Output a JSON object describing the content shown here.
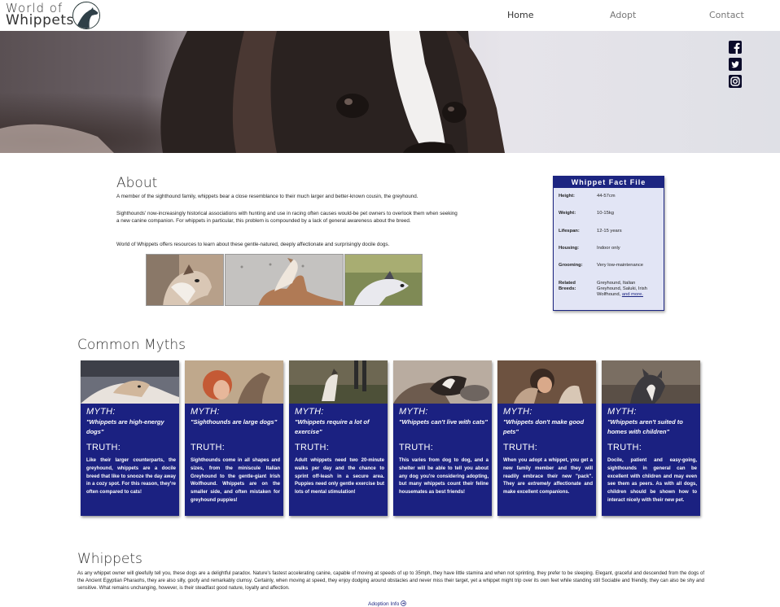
{
  "brand": {
    "line1": "World of",
    "line2": "Whippets",
    "icon": "whippet-head-icon"
  },
  "nav": {
    "items": [
      {
        "label": "Home",
        "active": true
      },
      {
        "label": "Adopt",
        "active": false
      },
      {
        "label": "Contact",
        "active": false
      }
    ]
  },
  "hero": {
    "social_icons": [
      "facebook-icon",
      "twitter-icon",
      "instagram-icon"
    ]
  },
  "about": {
    "title": "About",
    "paragraphs": [
      "A member of the sighthound family, whippets bear a close resemblance to their much larger and better-known cousin, the greyhound.",
      "Sighthounds' now-increasingly historical associations with hunting and use in racing often causes would-be pet owners to overlook them when seeking a new canine companion. For whippets in particular, this problem is compounded by a lack of general awareness about the breed.",
      "World of Whippets offers resources to learn about these gentle-natured, deeply affectionate and surprisingly docile dogs."
    ]
  },
  "fact_file": {
    "title": "Whippet Fact File",
    "rows": [
      {
        "key": "Height:",
        "value": "44-57cm"
      },
      {
        "key": "Weight:",
        "value": "10-15kg"
      },
      {
        "key": "Lifespan:",
        "value": "12-15 years"
      },
      {
        "key": "Housing:",
        "value": "Indoor only"
      },
      {
        "key": "Grooming:",
        "value": "Very low-maintenance"
      },
      {
        "key": "Related Breeds:",
        "value": "Greyhound, Italian Greyhound, Saluki, Irish Wolfhound,",
        "link": "and more."
      }
    ]
  },
  "myths": {
    "title": "Common Myths",
    "myth_heading": "MYTH:",
    "truth_heading": "TRUTH:",
    "cards": [
      {
        "myth": "\"Whippets are high-energy dogs\"",
        "truth": "Like their larger counterparts, the greyhound, whippets are a docile breed that like to snooze the day away in a cozy spot. For this reason, they're often compared to cats!"
      },
      {
        "myth": "\"Sighthounds are large dogs\"",
        "truth": "Sighthounds come in all shapes and sizes, from the miniscule Italian Greyhound to the gentle-giant Irish Wolfhound. Whippets are on the smaller side, and often mistaken for greyhound puppies!"
      },
      {
        "myth": "\"Whippets require a lot of exercise\"",
        "truth": "Adult whippets need two 20-minute walks per day and the chance to sprint off-leash in a secure area. Puppies need only gentle exercise but lots of mental stimulation!"
      },
      {
        "myth": "\"Whippets can't live with cats\"",
        "truth": "This varies from dog to dog, and a shelter will be able to tell you about any dog you're considering adopting, but many whippets count their feline housemates as best friends!"
      },
      {
        "myth": "\"Whippets don't make good pets\"",
        "truth_pre": "When you adopt a whippet, you get a new family member and they will readily embrace their new \"pack\". They are ",
        "truth_em": "extremely",
        "truth_post": " affectionate and make excellent companions."
      },
      {
        "myth": "\"Whippets aren't suited to homes with children\"",
        "truth": "Docile, patient and easy-going, sighthounds in general can be excellent with children and may even see them as peers. As with all dogs, children should be shown how to interact nicely with their new pet."
      }
    ]
  },
  "whippets": {
    "title": "Whippets",
    "paragraph": "As any whippet owner will gleefully tell you, these dogs are a delightful paradox. Nature's fastest accelerating canine, capable of moving at speeds of up to 35mph, they have little stamina and when not sprinting, they prefer to be sleeping. Elegant, graceful and descended from the dogs of the Ancient Egyptian Pharaohs, they are also silly, goofy and remarkably clumsy. Certainly, when moving at speed, they enjoy dodging around obstacles and never miss their target, yet a whippet might trip over its own feet while standing still Sociable and friendly, they can also be shy and sensitive. What remains unchanging, however, is their steadfast good nature, loyalty and affection.",
    "link": "Adoption Info",
    "link_icon": "arrow-circle-right-icon"
  }
}
